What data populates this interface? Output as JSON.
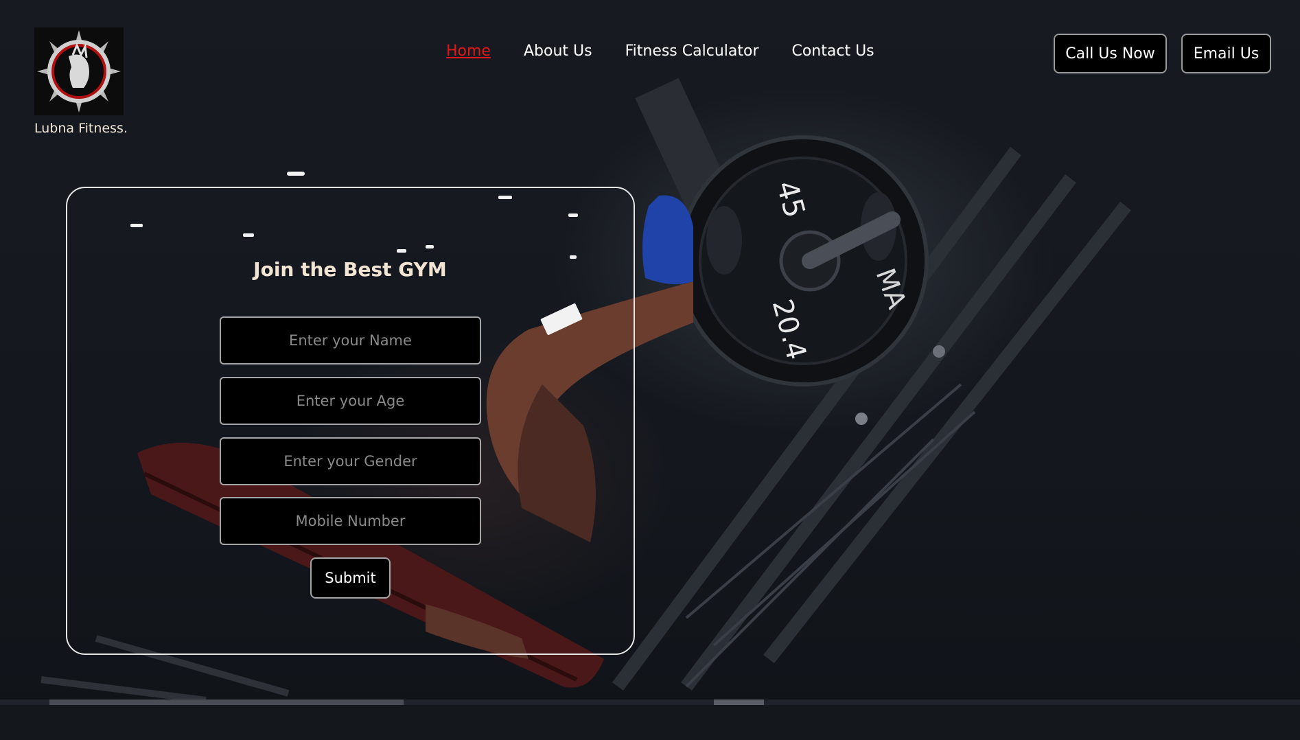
{
  "brand": {
    "name": "Lubna Fitness."
  },
  "nav": {
    "items": [
      {
        "label": "Home",
        "active": true
      },
      {
        "label": "About Us",
        "active": false
      },
      {
        "label": "Fitness Calculator",
        "active": false
      },
      {
        "label": "Contact Us",
        "active": false
      }
    ]
  },
  "header_buttons": {
    "call": "Call Us Now",
    "email": "Email Us"
  },
  "form": {
    "title": "Join the Best GYM",
    "fields": {
      "name": {
        "placeholder": "Enter your Name",
        "value": ""
      },
      "age": {
        "placeholder": "Enter your Age",
        "value": ""
      },
      "gender": {
        "placeholder": "Enter your Gender",
        "value": ""
      },
      "mobile": {
        "placeholder": "Mobile Number",
        "value": ""
      }
    },
    "submit_label": "Submit"
  },
  "plate": {
    "weight_top": "45",
    "weight_bottom": "20.4"
  },
  "colors": {
    "background": "#161a20",
    "nav_active": "#e01818",
    "brand_text": "#f1e6d6",
    "title_text": "#f3e5d3",
    "button_bg": "#000000"
  }
}
